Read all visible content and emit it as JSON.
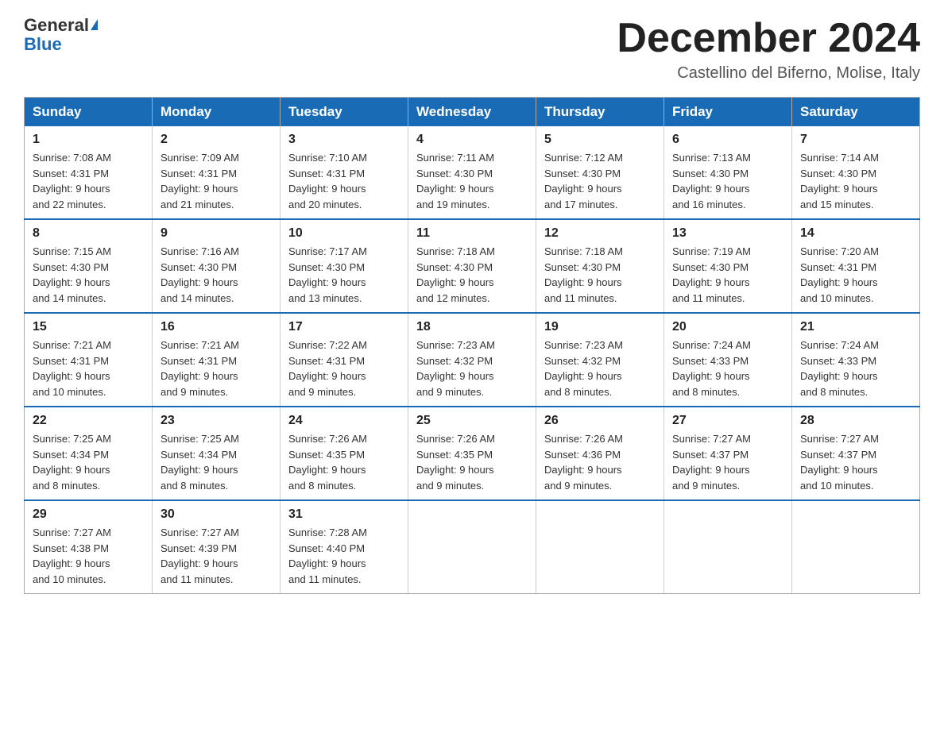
{
  "header": {
    "logo_general": "General",
    "logo_blue": "Blue",
    "month_title": "December 2024",
    "location": "Castellino del Biferno, Molise, Italy"
  },
  "days_of_week": [
    "Sunday",
    "Monday",
    "Tuesday",
    "Wednesday",
    "Thursday",
    "Friday",
    "Saturday"
  ],
  "weeks": [
    [
      {
        "day": "1",
        "sunrise": "7:08 AM",
        "sunset": "4:31 PM",
        "daylight": "9 hours and 22 minutes."
      },
      {
        "day": "2",
        "sunrise": "7:09 AM",
        "sunset": "4:31 PM",
        "daylight": "9 hours and 21 minutes."
      },
      {
        "day": "3",
        "sunrise": "7:10 AM",
        "sunset": "4:31 PM",
        "daylight": "9 hours and 20 minutes."
      },
      {
        "day": "4",
        "sunrise": "7:11 AM",
        "sunset": "4:30 PM",
        "daylight": "9 hours and 19 minutes."
      },
      {
        "day": "5",
        "sunrise": "7:12 AM",
        "sunset": "4:30 PM",
        "daylight": "9 hours and 17 minutes."
      },
      {
        "day": "6",
        "sunrise": "7:13 AM",
        "sunset": "4:30 PM",
        "daylight": "9 hours and 16 minutes."
      },
      {
        "day": "7",
        "sunrise": "7:14 AM",
        "sunset": "4:30 PM",
        "daylight": "9 hours and 15 minutes."
      }
    ],
    [
      {
        "day": "8",
        "sunrise": "7:15 AM",
        "sunset": "4:30 PM",
        "daylight": "9 hours and 14 minutes."
      },
      {
        "day": "9",
        "sunrise": "7:16 AM",
        "sunset": "4:30 PM",
        "daylight": "9 hours and 14 minutes."
      },
      {
        "day": "10",
        "sunrise": "7:17 AM",
        "sunset": "4:30 PM",
        "daylight": "9 hours and 13 minutes."
      },
      {
        "day": "11",
        "sunrise": "7:18 AM",
        "sunset": "4:30 PM",
        "daylight": "9 hours and 12 minutes."
      },
      {
        "day": "12",
        "sunrise": "7:18 AM",
        "sunset": "4:30 PM",
        "daylight": "9 hours and 11 minutes."
      },
      {
        "day": "13",
        "sunrise": "7:19 AM",
        "sunset": "4:30 PM",
        "daylight": "9 hours and 11 minutes."
      },
      {
        "day": "14",
        "sunrise": "7:20 AM",
        "sunset": "4:31 PM",
        "daylight": "9 hours and 10 minutes."
      }
    ],
    [
      {
        "day": "15",
        "sunrise": "7:21 AM",
        "sunset": "4:31 PM",
        "daylight": "9 hours and 10 minutes."
      },
      {
        "day": "16",
        "sunrise": "7:21 AM",
        "sunset": "4:31 PM",
        "daylight": "9 hours and 9 minutes."
      },
      {
        "day": "17",
        "sunrise": "7:22 AM",
        "sunset": "4:31 PM",
        "daylight": "9 hours and 9 minutes."
      },
      {
        "day": "18",
        "sunrise": "7:23 AM",
        "sunset": "4:32 PM",
        "daylight": "9 hours and 9 minutes."
      },
      {
        "day": "19",
        "sunrise": "7:23 AM",
        "sunset": "4:32 PM",
        "daylight": "9 hours and 8 minutes."
      },
      {
        "day": "20",
        "sunrise": "7:24 AM",
        "sunset": "4:33 PM",
        "daylight": "9 hours and 8 minutes."
      },
      {
        "day": "21",
        "sunrise": "7:24 AM",
        "sunset": "4:33 PM",
        "daylight": "9 hours and 8 minutes."
      }
    ],
    [
      {
        "day": "22",
        "sunrise": "7:25 AM",
        "sunset": "4:34 PM",
        "daylight": "9 hours and 8 minutes."
      },
      {
        "day": "23",
        "sunrise": "7:25 AM",
        "sunset": "4:34 PM",
        "daylight": "9 hours and 8 minutes."
      },
      {
        "day": "24",
        "sunrise": "7:26 AM",
        "sunset": "4:35 PM",
        "daylight": "9 hours and 8 minutes."
      },
      {
        "day": "25",
        "sunrise": "7:26 AM",
        "sunset": "4:35 PM",
        "daylight": "9 hours and 9 minutes."
      },
      {
        "day": "26",
        "sunrise": "7:26 AM",
        "sunset": "4:36 PM",
        "daylight": "9 hours and 9 minutes."
      },
      {
        "day": "27",
        "sunrise": "7:27 AM",
        "sunset": "4:37 PM",
        "daylight": "9 hours and 9 minutes."
      },
      {
        "day": "28",
        "sunrise": "7:27 AM",
        "sunset": "4:37 PM",
        "daylight": "9 hours and 10 minutes."
      }
    ],
    [
      {
        "day": "29",
        "sunrise": "7:27 AM",
        "sunset": "4:38 PM",
        "daylight": "9 hours and 10 minutes."
      },
      {
        "day": "30",
        "sunrise": "7:27 AM",
        "sunset": "4:39 PM",
        "daylight": "9 hours and 11 minutes."
      },
      {
        "day": "31",
        "sunrise": "7:28 AM",
        "sunset": "4:40 PM",
        "daylight": "9 hours and 11 minutes."
      },
      null,
      null,
      null,
      null
    ]
  ]
}
